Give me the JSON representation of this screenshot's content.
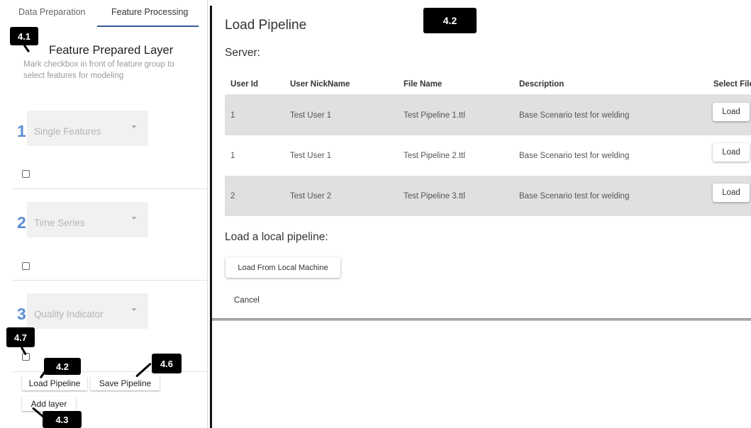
{
  "tabs": [
    {
      "label": "Data Preparation",
      "active": false
    },
    {
      "label": "Feature Processing",
      "active": true
    }
  ],
  "panel": {
    "title": "Feature Prepared Layer",
    "description": "Mark checkbox in front of feature group to select features for modeling",
    "features": [
      {
        "number": "1",
        "label": "Single Features"
      },
      {
        "number": "2",
        "label": "Time Series"
      },
      {
        "number": "3",
        "label": "Quality Indicator"
      }
    ],
    "buttons": {
      "load": "Load Pipeline",
      "save": "Save Pipeline",
      "add_layer": "Add layer"
    }
  },
  "dialog": {
    "title": "Load Pipeline",
    "server_label": "Server:",
    "columns": [
      "User Id",
      "User NickName",
      "File Name",
      "Description",
      "Select File"
    ],
    "rows": [
      {
        "user_id": "1",
        "nickname": "Test User 1",
        "file": "Test Pipeline 1.ttl",
        "description": "Base Scenario test for welding",
        "action": "Load"
      },
      {
        "user_id": "1",
        "nickname": "Test User 1",
        "file": "Test Pipeline 2.ttl",
        "description": "Base Scenario test for welding",
        "action": "Load"
      },
      {
        "user_id": "2",
        "nickname": "Test User 2",
        "file": "Test Pipeline 3.ttl",
        "description": "Base Scenario test for welding",
        "action": "Load"
      }
    ],
    "local_label": "Load a local pipeline:",
    "local_button": "Load From Local Machine",
    "cancel": "Cancel"
  },
  "callouts": [
    "4.1",
    "4.2",
    "4.7",
    "4.2",
    "4.6",
    "4.3"
  ],
  "colors": {
    "feature_number": "#5b8fd1",
    "tab_underline": "#3c5a9a",
    "row_shade": "#e0e0e0",
    "callout": "#000000"
  }
}
